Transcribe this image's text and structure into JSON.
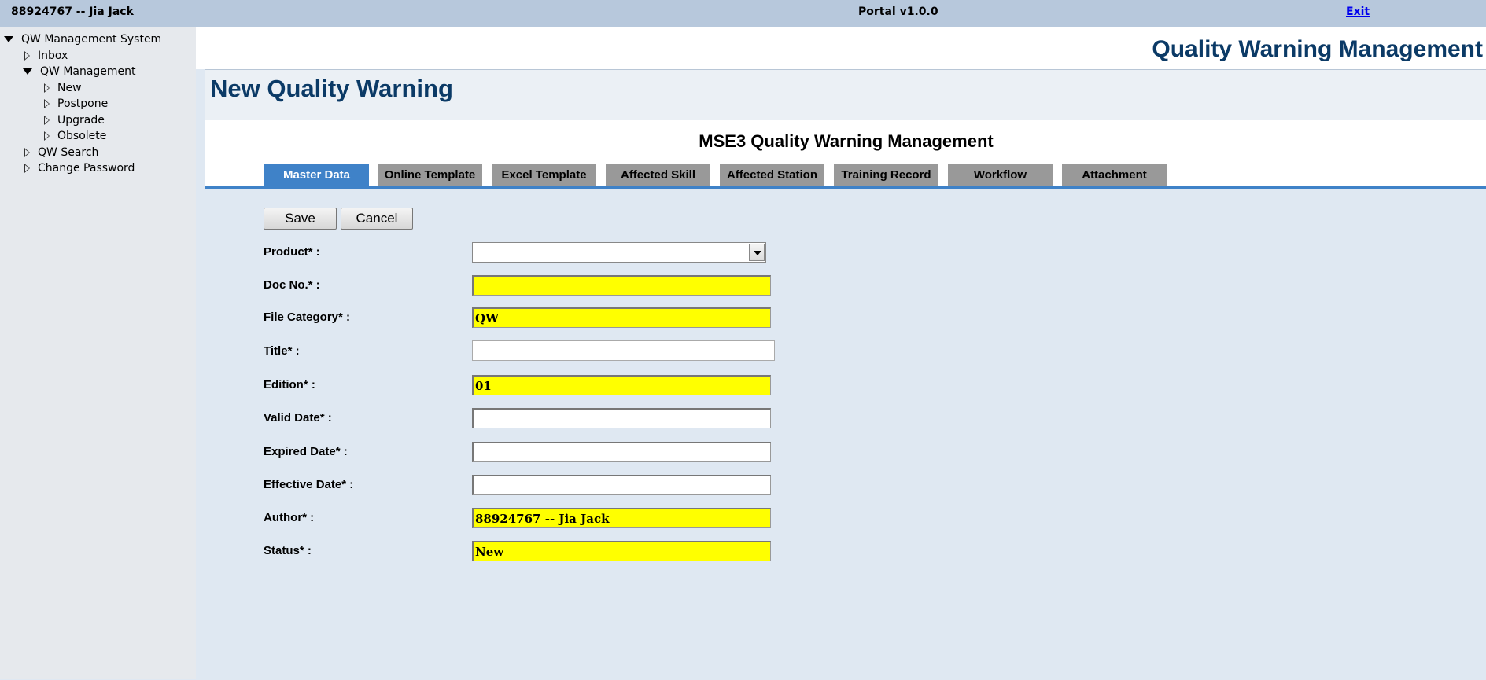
{
  "topbar": {
    "user": "88924767 -- Jia Jack",
    "portal": "Portal v1.0.0",
    "exit": "Exit"
  },
  "sidebar": {
    "root": "QW Management System",
    "inbox": "Inbox",
    "qw_management": "QW Management",
    "new": "New",
    "postpone": "Postpone",
    "upgrade": "Upgrade",
    "obsolete": "Obsolete",
    "qw_search": "QW Search",
    "change_password": "Change Password"
  },
  "header": {
    "app_title": "Quality Warning Management",
    "page_title": "New Quality Warning",
    "sub_title": "MSE3 Quality Warning Management"
  },
  "tabs": [
    {
      "label": "Master Data",
      "active": true
    },
    {
      "label": "Online Template"
    },
    {
      "label": "Excel Template"
    },
    {
      "label": "Affected Skill"
    },
    {
      "label": "Affected Station"
    },
    {
      "label": "Training Record"
    },
    {
      "label": "Workflow"
    },
    {
      "label": "Attachment"
    }
  ],
  "buttons": {
    "save": "Save",
    "cancel": "Cancel"
  },
  "form": {
    "product_label": "Product* :",
    "product_value": "",
    "doc_no_label": "Doc No.* :",
    "doc_no_value": "",
    "file_category_label": "File Category* :",
    "file_category_value": "QW",
    "title_label": "Title* :",
    "title_value": "",
    "edition_label": "Edition* :",
    "edition_value": "01",
    "valid_date_label": "Valid Date* :",
    "valid_date_value": "",
    "expired_date_label": "Expired Date* :",
    "expired_date_value": "",
    "effective_date_label": "Effective Date* :",
    "effective_date_value": "",
    "author_label": "Author* :",
    "author_value": "88924767 -- Jia Jack",
    "status_label": "Status* :",
    "status_value": "New"
  },
  "colors": {
    "required_field": "#ffff00",
    "active_tab": "#3f82c8",
    "inactive_tab": "#999999",
    "heading": "#0b3a66"
  }
}
